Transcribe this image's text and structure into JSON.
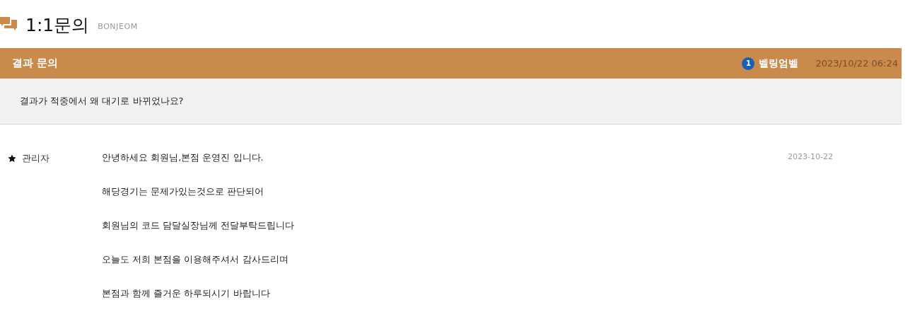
{
  "heading": {
    "title": "1:1문의",
    "subtitle": "BONJEOM"
  },
  "inquiry": {
    "title": "결과 문의",
    "badge": "1",
    "author": "벨링엄벨",
    "datetime": "2023/10/22 06:24",
    "question": "결과가 적중에서 왜 대기로 바뀌었나요?"
  },
  "reply": {
    "author": "관리자",
    "date": "2023-10-22",
    "lines": [
      "안녕하세요 회원님,본점 운영진 입니다.",
      "해당경기는 문제가있는것으로 판단되어",
      "회원님의 코드 담달실장님께 전달부탁드립니다",
      "오늘도 저희 본점을 이용해주셔서 감사드리며",
      "본점과 함께 즐거운 하루되시기 바랍니다"
    ]
  }
}
